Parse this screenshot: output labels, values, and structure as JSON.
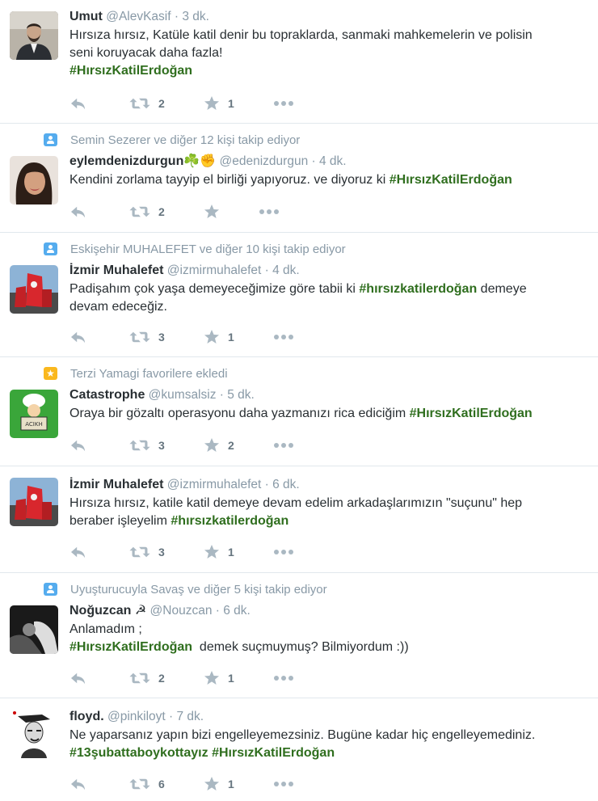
{
  "tweets": [
    {
      "context": "",
      "name": "Umut",
      "handle": "@AlevKasif",
      "time": "· 3 dk.",
      "line1": "Hırsıza hırsız, Katüle katil denir bu topraklarda, sanmaki mahkemelerin ve polisin",
      "line2": "seni koruyacak daha fazla!",
      "hashtag": "#HırsızKatilErdoğan",
      "retweets": "2",
      "favorites": "1"
    },
    {
      "context": "Semin Sezerer ve diğer 12 kişi takip ediyor",
      "name": "eylemdenizdurgun☘️✊️",
      "handle": "@edenizdurgun",
      "time": "· 4 dk.",
      "text": "Kendini zorlama tayyip el birliği yapıyoruz. ve diyoruz ki ",
      "hashtag": "#HırsızKatilErdoğan",
      "retweets": "2",
      "favorites": ""
    },
    {
      "context": "Eskişehir MUHALEFET ve diğer 10 kişi takip ediyor",
      "name": "İzmir Muhalefet",
      "handle": "@izmirmuhalefet",
      "time": "· 4 dk.",
      "text_before": "Padişahım çok yaşa demeyeceğimize göre tabii ki ",
      "hashtag": "#hırsızkatilerdoğan",
      "text_after": " demeye",
      "line2": "devam edeceğiz.",
      "retweets": "3",
      "favorites": "1"
    },
    {
      "context": "Terzi Yamagi favorilere ekledi",
      "name": "Catastrophe",
      "handle": "@kumsalsiz",
      "time": "· 5 dk.",
      "text": "Oraya bir gözaltı operasyonu daha yazmanızı rica ediciğim ",
      "hashtag": "#HırsızKatilErdoğan",
      "retweets": "3",
      "favorites": "2"
    },
    {
      "context": "",
      "name": "İzmir Muhalefet",
      "handle": "@izmirmuhalefet",
      "time": "· 6 dk.",
      "line1": "Hırsıza hırsız, katile katil demeye devam edelim arkadaşlarımızın \"suçunu\" hep",
      "line2": "beraber işleyelim ",
      "hashtag": "#hırsızkatilerdoğan",
      "retweets": "3",
      "favorites": "1"
    },
    {
      "context": "Uyuşturucuyla Savaş ve diğer 5 kişi takip ediyor",
      "name": "Noğuzcan ☭",
      "handle": "@Nouzcan",
      "time": "· 6 dk.",
      "line1": "Anlamadım ;",
      "hashtag": "#HırsızKatilErdoğan",
      "line2_after": "  demek suçmuymuş? Bilmiyordum :))",
      "retweets": "2",
      "favorites": "1"
    },
    {
      "context": "",
      "name": "floyd.",
      "handle": "@pinkiloyt",
      "time": "· 7 dk.",
      "line1": "Ne yaparsanız yapın bizi engelleyemezsiniz. Bugüne kadar hiç engelleyemediniz.",
      "hashtag1": "#13şubattaboykottayız",
      "hashtag2": "#HırsızKatilErdoğan",
      "retweets": "6",
      "favorites": "1"
    }
  ],
  "colors": {
    "hashtag": "#2f6e1e",
    "meta": "#8899a6",
    "follow_icon": "#55acee",
    "favorite_icon": "#fab81e"
  },
  "icons": [
    "reply-icon",
    "retweet-icon",
    "favorite-icon",
    "more-icon",
    "follow-context-icon",
    "favorite-context-icon"
  ]
}
